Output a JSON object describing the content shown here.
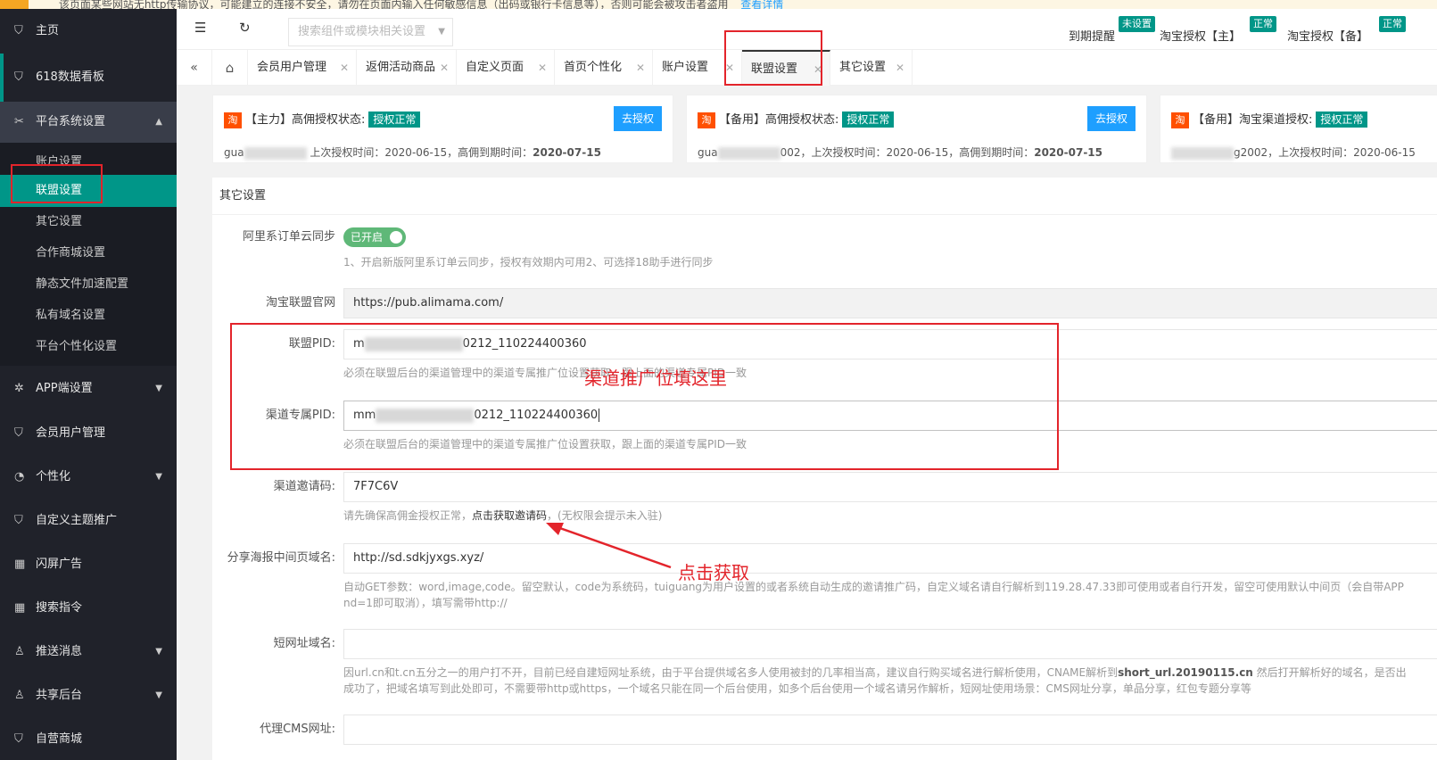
{
  "notice": {
    "text": "该页面某些网站无http传输协议，可能建立的连接不安全，请勿在页面内输入任何敏感信息（出码或银行卡信息等），否则可能会被攻击者盗用",
    "link": "查看详情"
  },
  "sidebar": {
    "items": [
      {
        "icon": "shield-icon",
        "label": "主页"
      },
      {
        "icon": "shield-icon",
        "label": "618数据看板"
      },
      {
        "icon": "tools-icon",
        "label": "平台系统设置"
      }
    ],
    "subitems": [
      "账户设置",
      "联盟设置",
      "其它设置",
      "合作商城设置",
      "静态文件加速配置",
      "私有域名设置",
      "平台个性化设置"
    ],
    "items2": [
      {
        "icon": "gear-icon",
        "label": "APP端设置"
      },
      {
        "icon": "shield-icon",
        "label": "会员用户管理"
      },
      {
        "icon": "palette-icon",
        "label": "个性化"
      },
      {
        "icon": "shield-icon",
        "label": "自定义主题推广"
      },
      {
        "icon": "apps-icon",
        "label": "闪屏广告"
      },
      {
        "icon": "apps-icon",
        "label": "搜索指令"
      },
      {
        "icon": "user-icon",
        "label": "推送消息"
      },
      {
        "icon": "user-icon",
        "label": "共享后台"
      },
      {
        "icon": "shield-icon",
        "label": "自营商城"
      }
    ]
  },
  "header": {
    "search_placeholder": "搜索组件或模块相关设置",
    "expire_label": "到期提醒",
    "expire_badge": "未设置",
    "tb_main_label": "淘宝授权【主】",
    "tb_main_badge": "正常",
    "tb_backup_label": "淘宝授权【备】",
    "tb_backup_badge": "正常"
  },
  "tabs": [
    "会员用户管理",
    "返佣活动商品",
    "自定义页面",
    "首页个性化",
    "账户设置",
    "联盟设置",
    "其它设置"
  ],
  "cards": [
    {
      "tag": "淘",
      "title": "【主力】高佣授权状态:",
      "status": "授权正常",
      "button": "去授权",
      "prefix": "gua",
      "mid": "",
      "info": "上次授权时间：2020-06-15，高佣到期时间：",
      "date": "2020-07-15"
    },
    {
      "tag": "淘",
      "title": "【备用】高佣授权状态:",
      "status": "授权正常",
      "button": "去授权",
      "prefix": "gua",
      "mid": "002，",
      "info": "上次授权时间：2020-06-15，高佣到期时间：",
      "date": "2020-07-15"
    },
    {
      "tag": "淘",
      "title": "【备用】淘宝渠道授权:",
      "status": "授权正常",
      "prefix": "",
      "mid": "g2002，",
      "info": "上次授权时间：2020-06-15"
    }
  ],
  "panel": {
    "title": "其它设置",
    "sync_label": "阿里系订单云同步",
    "sync_toggle": "已开启",
    "sync_hint": "1、开启新版阿里系订单云同步，授权有效期内可用2、可选择18助手进行同步",
    "site_label": "淘宝联盟官网",
    "site_value": "https://pub.alimama.com/",
    "pid_label": "联盟PID:",
    "pid_prefix": "m",
    "pid_suffix": "0212_110224400360",
    "pid_hint": "必须在联盟后台的渠道管理中的渠道专属推广位设置获取，跟上面的渠道专属PID一致",
    "cpid_label": "渠道专属PID:",
    "cpid_prefix": "mm",
    "cpid_suffix": "0212_110224400360",
    "cpid_hint": "必须在联盟后台的渠道管理中的渠道专属推广位设置获取，跟上面的渠道专属PID一致",
    "invite_label": "渠道邀请码:",
    "invite_value": "7F7C6V",
    "invite_hint_pre": "请先确保高佣金授权正常，",
    "invite_hint_link": "点击获取邀请码",
    "invite_hint_post": "，(无权限会提示未入驻)",
    "share_label": "分享海报中间页域名:",
    "share_value": "http://sd.sdkjyxgs.xyz/",
    "share_hint1": "自动GET参数：word,image,code。留空默认，code为系统码，tuiguang为用户设置的或者系统自动生成的邀请推广码，自定义域名请自行解析到119.28.47.33即可使用或者自行开发，留空可使用默认中间页（会自带APP",
    "share_hint2": "nd=1即可取消），填写需带http://",
    "short_label": "短网址域名:",
    "short_hint1_pre": "因url.cn和t.cn五分之一的用户打不开，目前已经自建短网址系统，由于平台提供域名多人使用被封的几率相当高，建议自行购买域名进行解析使用，CNAME解析到",
    "short_hint1_bold": "short_url.20190115.cn",
    "short_hint1_post": " 然后打开解析好的域名，是否出",
    "short_hint2": "成功了，把域名填写到此处即可，不需要带http或https，一个域名只能在同一个后台使用，如多个后台使用一个域名请另作解析，短网址使用场景：CMS网址分享，单品分享，红包专题分享等",
    "cms_label": "代理CMS网址:"
  },
  "annotations": {
    "pid_note": "渠道推广位填这里",
    "click_note": "点击获取"
  }
}
